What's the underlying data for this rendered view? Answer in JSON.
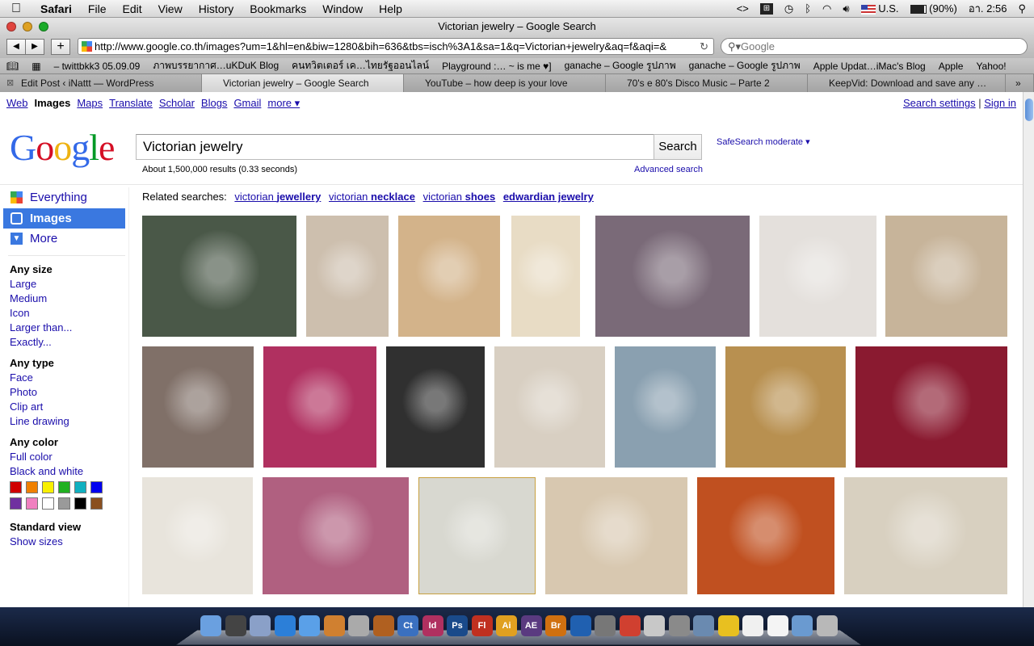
{
  "menubar": {
    "app": "Safari",
    "items": [
      "File",
      "Edit",
      "View",
      "History",
      "Bookmarks",
      "Window",
      "Help"
    ],
    "battery": "(90%)",
    "input_source": "U.S.",
    "clock": "อา. 2:56"
  },
  "window": {
    "title": "Victorian jewelry – Google Search",
    "url": "http://www.google.co.th/images?um=1&hl=en&biw=1280&bih=636&tbs=isch%3A1&sa=1&q=Victorian+jewelry&aq=f&aqi=&",
    "search_placeholder": "Google"
  },
  "bookmarks": [
    "– twittbkk3 05.09.09",
    "ภาพบรรยากาศ…uKDuK Blog",
    "คนทวิตเตอร์ เค…ไทยรัฐออนไลน์",
    "Playground :… ~ is me ♥]",
    "ganache – Google รูปภาพ",
    "ganache – Google รูปภาพ",
    "Apple Updat…iMac's Blog",
    "Apple",
    "Yahoo!"
  ],
  "tabs": [
    {
      "label": "Edit Post ‹ iNattt — WordPress",
      "active": false
    },
    {
      "label": "Victorian jewelry – Google Search",
      "active": true
    },
    {
      "label": "YouTube – how deep is your love",
      "active": false
    },
    {
      "label": "70's e 80's Disco Music – Parte 2",
      "active": false
    },
    {
      "label": "KeepVid: Download and save any …",
      "active": false
    }
  ],
  "gbar": {
    "items": [
      "Web",
      "Images",
      "Maps",
      "Translate",
      "Scholar",
      "Blogs",
      "Gmail",
      "more ▾"
    ],
    "current": "Images",
    "settings": "Search settings",
    "signin": "Sign in"
  },
  "search": {
    "query": "Victorian jewelry",
    "button": "Search",
    "safesearch": "SafeSearch moderate ▾",
    "stats": "About 1,500,000 results (0.33 seconds)",
    "advanced": "Advanced search"
  },
  "sidebar": {
    "modes": [
      "Everything",
      "Images",
      "More"
    ],
    "size_header": "Any size",
    "sizes": [
      "Large",
      "Medium",
      "Icon",
      "Larger than...",
      "Exactly..."
    ],
    "type_header": "Any type",
    "types": [
      "Face",
      "Photo",
      "Clip art",
      "Line drawing"
    ],
    "color_header": "Any color",
    "colors_text": [
      "Full color",
      "Black and white"
    ],
    "swatches": [
      "#d00000",
      "#f08000",
      "#f8f000",
      "#20b020",
      "#10b0c0",
      "#0000f0",
      "#7030a0",
      "#f080c0",
      "#ffffff",
      "#9a9a9a",
      "#000000",
      "#8a5020"
    ],
    "view_header": "Standard view",
    "view_link": "Show sizes"
  },
  "related": {
    "label": "Related searches:",
    "items": [
      {
        "pre": "victorian ",
        "bold": "jewellery"
      },
      {
        "pre": "victorian ",
        "bold": "necklace"
      },
      {
        "pre": "victorian ",
        "bold": "shoes"
      },
      {
        "pre": "",
        "bold": "edwardian jewelry"
      }
    ]
  },
  "thumb_colors": [
    [
      "#4a5848",
      "#cdbfae",
      "#d3b38a",
      "#e8dcc5",
      "#7a6a78",
      "#e4e0dc",
      "#c7b49a"
    ],
    [
      "#807068",
      "#b03060",
      "#303030",
      "#d8cfc2",
      "#8aa0b0",
      "#b89050",
      "#8a1a30"
    ],
    [
      "#e8e4dc",
      "#b06080",
      "#d8d8d0",
      "#d8c8b0",
      "#c05020",
      "#d8d0c0"
    ]
  ],
  "dock": [
    "Finder",
    "Dashboard",
    "Preview",
    "Safari",
    "iTunes",
    "iPhoto",
    "iMovie",
    "GarageBand",
    "Ct",
    "Id",
    "Ps",
    "Fl",
    "Ai",
    "AE",
    "Br",
    "Xcode",
    "Photo Booth",
    "Chrome",
    "Pages",
    "System Preferences",
    "Mail",
    "Sketch",
    "Calendar",
    "TextEdit",
    "Folder",
    "Trash"
  ]
}
